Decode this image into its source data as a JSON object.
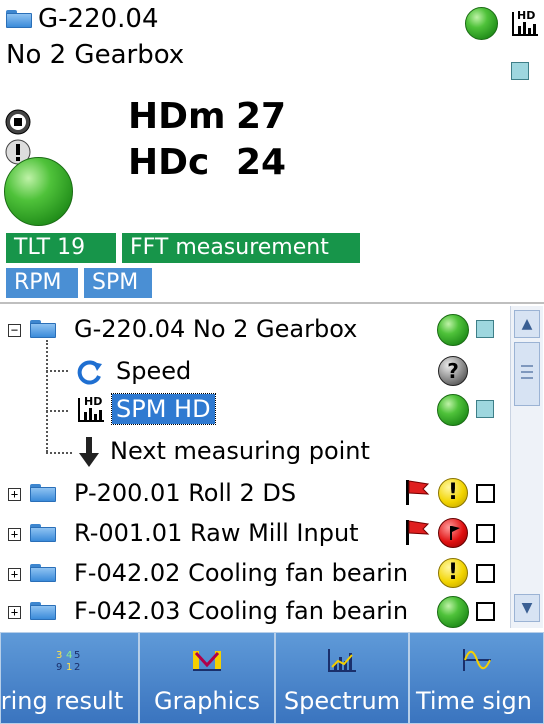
{
  "header": {
    "point_id": "G-220.04",
    "point_name": "No 2 Gearbox",
    "hd_badge": "HD",
    "status_color": "#2e9c22"
  },
  "readings": {
    "hdm_label": "HDm",
    "hdm_value": "27",
    "hdc_label": "HDc",
    "hdc_value": "24"
  },
  "tags": {
    "row1": [
      "TLT 19",
      "FFT measurement"
    ],
    "row2": [
      "RPM",
      "SPM"
    ],
    "green": "#17954a",
    "blue": "#4a8fd4"
  },
  "tree": {
    "parent": {
      "label": "G-220.04 No 2 Gearbox",
      "expand": "−"
    },
    "children": [
      {
        "label": "Speed",
        "icon": "refresh-icon"
      },
      {
        "label": "SPM HD",
        "icon": "spm-hd-icon",
        "hd": "HD"
      },
      {
        "label": "Next measuring point",
        "icon": "arrow-down-icon"
      }
    ],
    "items": [
      {
        "label": "P-200.01 Roll 2 DS",
        "expand": "+",
        "status": "warning"
      },
      {
        "label": "R-001.01 Raw Mill Input",
        "expand": "+",
        "status": "alarm"
      },
      {
        "label": "F-042.02 Cooling fan bearin",
        "expand": "+",
        "status": "warning"
      },
      {
        "label": "F-042.03 Cooling fan bearin",
        "expand": "+",
        "status": "ok"
      }
    ],
    "warn_glyph": "!",
    "question_glyph": "?"
  },
  "toolbar": {
    "buttons": [
      {
        "label": "ring result",
        "icon": "measuring-result-icon"
      },
      {
        "label": "Graphics",
        "icon": "graphics-icon"
      },
      {
        "label": "Spectrum",
        "icon": "spectrum-icon"
      },
      {
        "label": "Time sign",
        "icon": "time-signal-icon"
      }
    ]
  },
  "scrollbar": {
    "up": "▲",
    "down": "▼"
  }
}
